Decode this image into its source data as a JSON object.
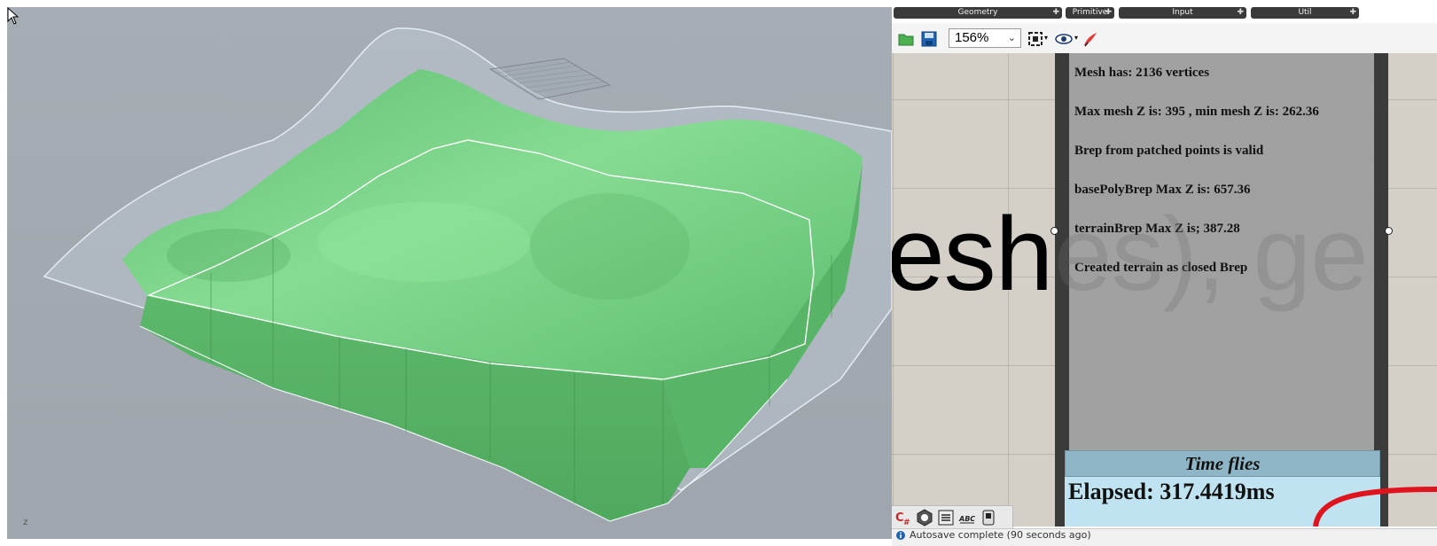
{
  "viewport": {
    "axis_label": "z",
    "colors": {
      "terrain": "#6cc97b",
      "terrain_light": "#8fe29a",
      "outline": "#e8eef4"
    }
  },
  "grasshopper": {
    "tabs": [
      {
        "label": "Geometry"
      },
      {
        "label": "Primitive"
      },
      {
        "label": "Input"
      },
      {
        "label": "Util"
      }
    ],
    "toolbar": {
      "zoom_value": "156%"
    },
    "canvas": {
      "background_text": "esh",
      "overlay_text": "es), ge"
    },
    "panel": {
      "lines": [
        "Mesh has: 2136 vertices",
        "Max mesh Z is: 395 , min mesh Z is: 262.36",
        "Brep from patched points is valid",
        "basePolyBrep Max Z is: 657.36",
        "terrainBrep Max Z is; 387.28",
        "Created terrain as closed Brep"
      ]
    },
    "timer": {
      "title": "Time flies",
      "value": "Elapsed: 317.4419ms"
    },
    "status": {
      "text": "Autosave complete (90 seconds ago)"
    }
  }
}
